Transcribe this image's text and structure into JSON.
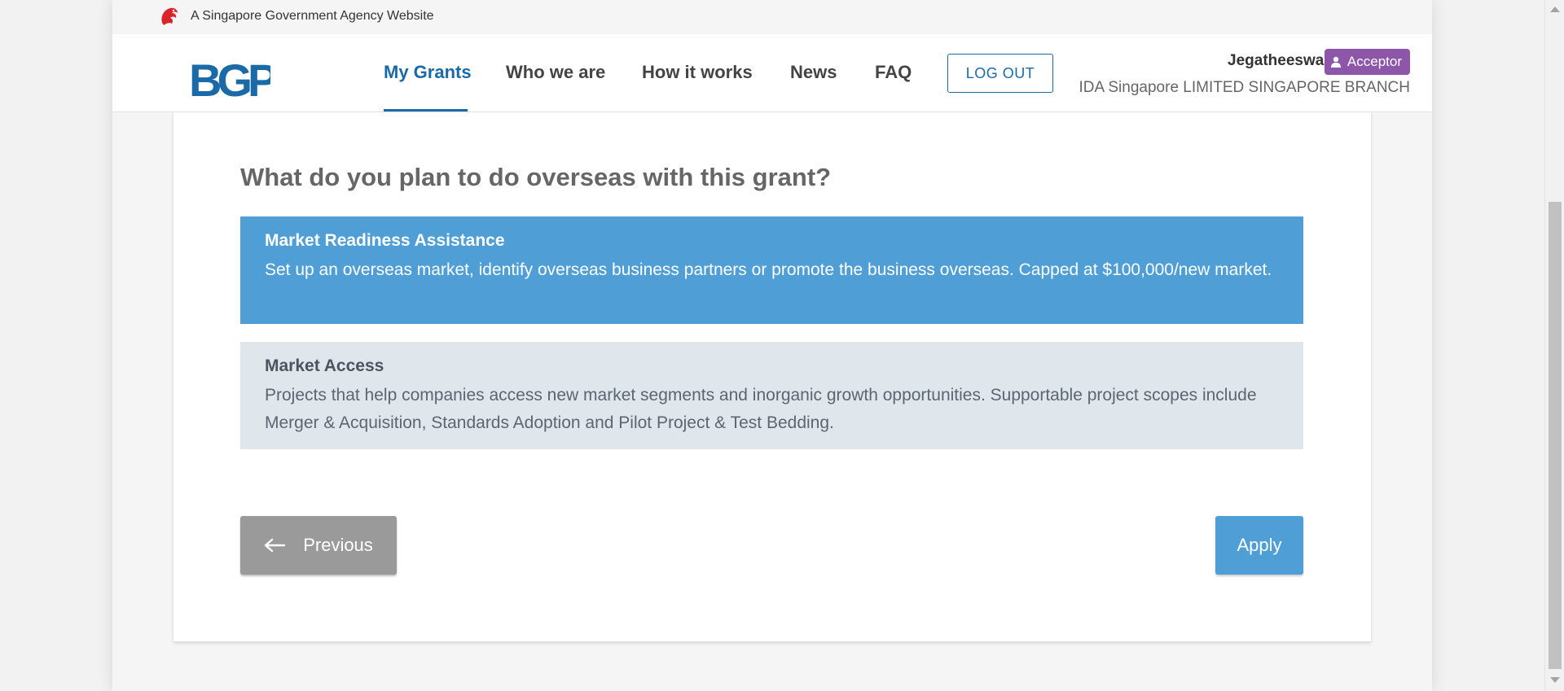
{
  "gov_banner": {
    "text": "A Singapore Government Agency Website",
    "icon": "merlion-icon"
  },
  "brand": {
    "logo_text": "BGP",
    "logo_color": "#1a6aa8"
  },
  "nav": {
    "items": [
      {
        "label": "My Grants",
        "active": true
      },
      {
        "label": "Who we are",
        "active": false
      },
      {
        "label": "How it works",
        "active": false
      },
      {
        "label": "News",
        "active": false
      },
      {
        "label": "FAQ",
        "active": false
      }
    ],
    "logout_label": "LOG OUT"
  },
  "user": {
    "name": "Jegatheeswari",
    "role": "Acceptor",
    "role_icon": "user-icon",
    "role_color": "#8e56a8",
    "organization": "IDA Singapore LIMITED SINGAPORE BRANCH"
  },
  "form": {
    "question": "What do you plan to do overseas with this grant?",
    "options": [
      {
        "title": "Market Readiness Assistance",
        "description": "Set up an overseas market, identify overseas business partners or promote the business overseas. Capped at $100,000/new market.",
        "selected": true
      },
      {
        "title": "Market Access",
        "description": "Projects that help companies access new market segments and inorganic growth opportunities. Supportable project scopes include Merger & Acquisition, Standards Adoption and Pilot Project & Test Bedding.",
        "selected": false
      }
    ],
    "previous_label": "Previous",
    "apply_label": "Apply"
  },
  "colors": {
    "accent": "#1a6aa8",
    "selected_option": "#4f9fd6",
    "unselected_option": "#dfe6ec",
    "previous_button": "#9a9a9a"
  }
}
